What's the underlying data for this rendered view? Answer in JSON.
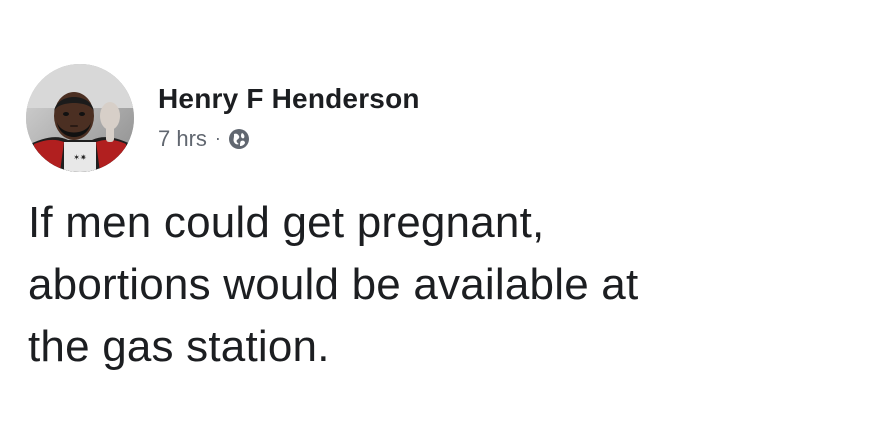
{
  "post": {
    "author": "Henry F Henderson",
    "timestamp": "7 hrs",
    "separator": "·",
    "privacy_icon": "globe-icon",
    "text_lines": [
      "If men could get pregnant,",
      "abortions would be available at",
      "the gas station."
    ]
  },
  "colors": {
    "background": "#ffffff",
    "text_primary": "#1c1e21",
    "text_secondary": "#616770"
  }
}
